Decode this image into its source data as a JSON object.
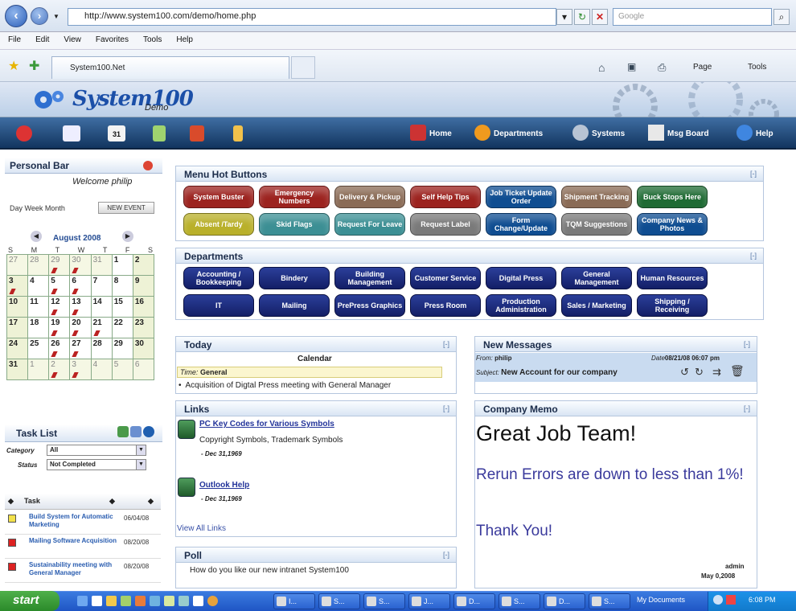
{
  "browser": {
    "url": "http://www.system100.com/demo/home.php",
    "search_placeholder": "Google",
    "menus": [
      "File",
      "Edit",
      "View",
      "Favorites",
      "Tools",
      "Help"
    ],
    "tab_title": "System100.Net",
    "toolbar": {
      "page": "Page",
      "tools": "Tools"
    }
  },
  "site": {
    "logo": "System100",
    "logo_sub": "Demo",
    "nav": {
      "home": "Home",
      "departments": "Departments",
      "systems": "Systems",
      "msg_board": "Msg Board",
      "help": "Help"
    }
  },
  "personal_bar": {
    "title": "Personal Bar",
    "welcome": "Welcome philip",
    "views": "Day  Week  Month",
    "new_event": "NEW EVENT",
    "month": "August 2008",
    "dow": [
      "S",
      "M",
      "T",
      "W",
      "T",
      "F",
      "S"
    ],
    "weeks": [
      [
        {
          "d": "27",
          "o": 1
        },
        {
          "d": "28",
          "o": 1
        },
        {
          "d": "29",
          "o": 1,
          "e": 1
        },
        {
          "d": "30",
          "o": 1,
          "e": 1
        },
        {
          "d": "31",
          "o": 1
        },
        {
          "d": "1"
        },
        {
          "d": "2",
          "w": 1
        }
      ],
      [
        {
          "d": "3",
          "w": 1,
          "e": 1
        },
        {
          "d": "4"
        },
        {
          "d": "5",
          "e": 1
        },
        {
          "d": "6",
          "e": 1
        },
        {
          "d": "7"
        },
        {
          "d": "8"
        },
        {
          "d": "9",
          "w": 1
        }
      ],
      [
        {
          "d": "10",
          "w": 1
        },
        {
          "d": "11"
        },
        {
          "d": "12",
          "e": 1
        },
        {
          "d": "13",
          "e": 1
        },
        {
          "d": "14"
        },
        {
          "d": "15"
        },
        {
          "d": "16",
          "w": 1
        }
      ],
      [
        {
          "d": "17",
          "w": 1
        },
        {
          "d": "18"
        },
        {
          "d": "19",
          "e": 1
        },
        {
          "d": "20",
          "e": 1
        },
        {
          "d": "21",
          "e": 1
        },
        {
          "d": "22"
        },
        {
          "d": "23",
          "w": 1
        }
      ],
      [
        {
          "d": "24",
          "w": 1
        },
        {
          "d": "25"
        },
        {
          "d": "26",
          "e": 1
        },
        {
          "d": "27",
          "e": 1
        },
        {
          "d": "28"
        },
        {
          "d": "29"
        },
        {
          "d": "30",
          "w": 1
        }
      ],
      [
        {
          "d": "31",
          "w": 1
        },
        {
          "d": "1",
          "o": 1
        },
        {
          "d": "2",
          "o": 1,
          "e": 1
        },
        {
          "d": "3",
          "o": 1,
          "e": 1
        },
        {
          "d": "4",
          "o": 1
        },
        {
          "d": "5",
          "o": 1
        },
        {
          "d": "6",
          "o": 1
        }
      ]
    ]
  },
  "task_list": {
    "title": "Task List",
    "category_label": "Category",
    "category_value": "All",
    "status_label": "Status",
    "status_value": "Not Completed",
    "col_task": "Task",
    "tasks": [
      {
        "name": "Build System for Automatic Marketing",
        "date": "06/04/08",
        "flag": "#f2e14a"
      },
      {
        "name": "Mailing Software Acquisition",
        "date": "08/20/08",
        "flag": "#d22"
      },
      {
        "name": "Sustainability meeting with General Manager",
        "date": "08/20/08",
        "flag": "#d22"
      }
    ]
  },
  "hot_buttons": {
    "title": "Menu Hot Buttons",
    "collapse": "[-]",
    "row1": [
      {
        "label": "System Buster",
        "color": "red"
      },
      {
        "label": "Emergency Numbers",
        "color": "red"
      },
      {
        "label": "Delivery & Pickup",
        "color": "brown"
      },
      {
        "label": "Self Help Tips",
        "color": "red"
      },
      {
        "label": "Job Ticket Update Order",
        "color": "blue"
      },
      {
        "label": "Shipment Tracking",
        "color": "brown"
      },
      {
        "label": "Buck Stops Here",
        "color": "green"
      }
    ],
    "row2": [
      {
        "label": "Absent /Tardy",
        "color": "yellow"
      },
      {
        "label": "Skid Flags",
        "color": "teal"
      },
      {
        "label": "Request For Leave",
        "color": "teal"
      },
      {
        "label": "Request Label",
        "color": "grey"
      },
      {
        "label": "Form Change/Update",
        "color": "blue"
      },
      {
        "label": "TQM Suggestions",
        "color": "grey"
      },
      {
        "label": "Company News & Photos",
        "color": "blue"
      }
    ]
  },
  "departments": {
    "title": "Departments",
    "collapse": "[-]",
    "row1": [
      "Accounting / Bookkeeping",
      "Bindery",
      "Building Management",
      "Customer Service",
      "Digital Press",
      "General Management",
      "Human Resources"
    ],
    "row2": [
      "IT",
      "Mailing",
      "PrePress Graphics",
      "Press Room",
      "Production Administration",
      "Sales / Marketing",
      "Shipping / Receiving"
    ]
  },
  "today": {
    "title": "Today",
    "collapse": "[-]",
    "calendar_label": "Calendar",
    "time_label": "Time:",
    "time_value": "General",
    "item": "Acquisition of Digtal Press meeting with General Manager"
  },
  "links": {
    "title": "Links",
    "collapse": "[-]",
    "items": [
      {
        "title": "PC Key Codes for Various Symbols",
        "desc": "Copyright Symbols, Trademark Symbols",
        "date": "- Dec 31,1969"
      },
      {
        "title": "Outlook Help",
        "desc": "",
        "date": "- Dec 31,1969"
      }
    ],
    "view_all": "View All Links"
  },
  "poll": {
    "title": "Poll",
    "collapse": "[-]",
    "question": "How do you like our new intranet System100"
  },
  "messages": {
    "title": "New Messages",
    "collapse": "[-]",
    "from_label": "From:",
    "from": "philip",
    "date_label": "Date",
    "date": "08/21/08 06:07 pm",
    "subject_label": "Subject:",
    "subject": "New Account for our company"
  },
  "memo": {
    "title": "Company Memo",
    "collapse": "[-]",
    "headline": "Great Job Team!",
    "line1": "Rerun Errors are down to less than 1%!",
    "line2": "Thank You!",
    "author": "admin",
    "date": "May 0,2008"
  },
  "taskbar": {
    "start": "start",
    "buttons": [
      "I...",
      "S...",
      "S...",
      "J...",
      "D...",
      "S...",
      "D...",
      "S..."
    ],
    "folder": "My Documents",
    "time": "6:08 PM"
  }
}
